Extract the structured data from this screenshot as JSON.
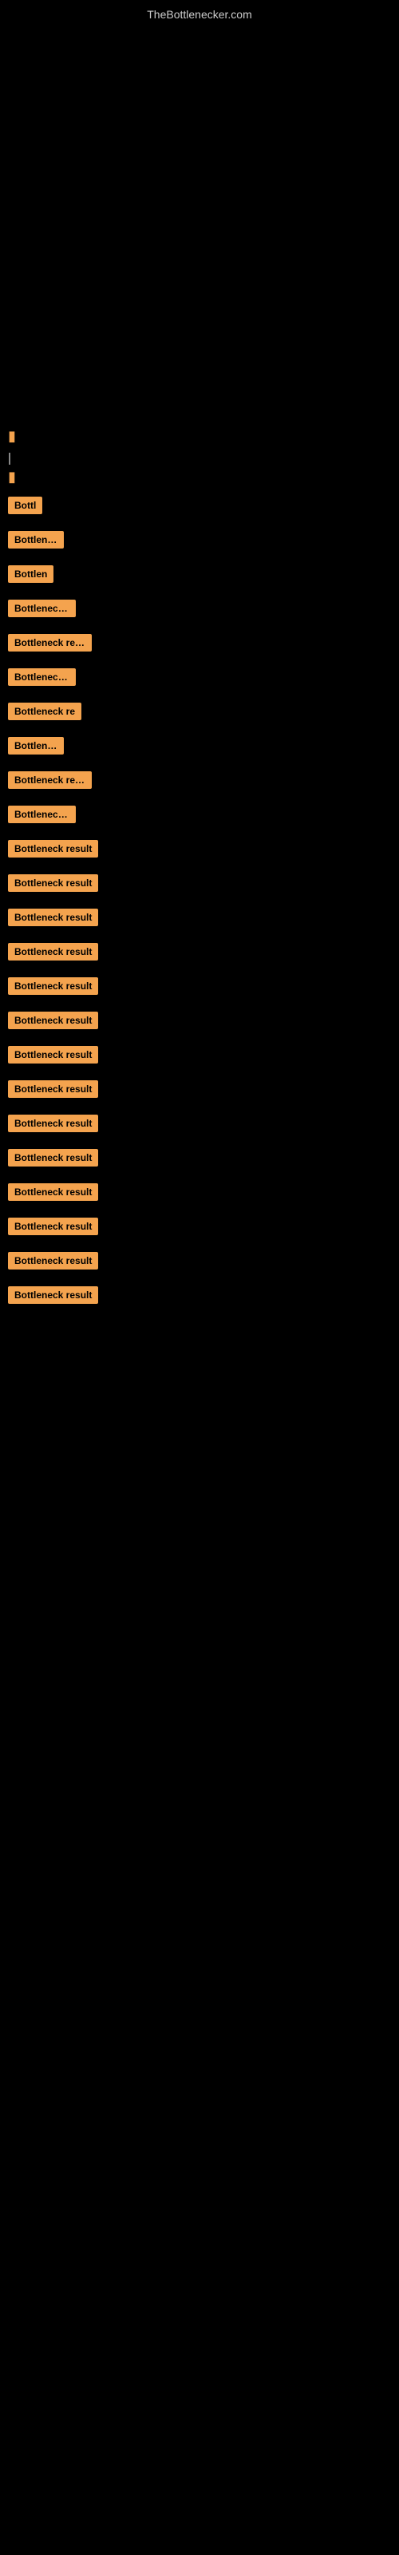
{
  "site": {
    "title": "TheBottlenecker.com"
  },
  "sections": [
    {
      "id": 1,
      "label": "Bottl",
      "size_class": "label-xs",
      "visible": true
    },
    {
      "id": 2,
      "label": "Bottleneck",
      "size_class": "label-sm",
      "visible": true
    },
    {
      "id": 3,
      "label": "Bottlen",
      "size_class": "label-sm",
      "visible": true
    },
    {
      "id": 4,
      "label": "Bottleneck r",
      "size_class": "label-md",
      "visible": true
    },
    {
      "id": 5,
      "label": "Bottleneck resu",
      "size_class": "label-lg",
      "visible": true
    },
    {
      "id": 6,
      "label": "Bottleneck r",
      "size_class": "label-md",
      "visible": true
    },
    {
      "id": 7,
      "label": "Bottleneck re",
      "size_class": "label-lg",
      "visible": true
    },
    {
      "id": 8,
      "label": "Bottleneck",
      "size_class": "label-sm",
      "visible": true
    },
    {
      "id": 9,
      "label": "Bottleneck resu",
      "size_class": "label-lg",
      "visible": true
    },
    {
      "id": 10,
      "label": "Bottleneck re",
      "size_class": "label-md",
      "visible": true
    },
    {
      "id": 11,
      "label": "Bottleneck result",
      "size_class": "label-xl",
      "visible": true
    },
    {
      "id": 12,
      "label": "Bottleneck result",
      "size_class": "label-xl",
      "visible": true
    },
    {
      "id": 13,
      "label": "Bottleneck result",
      "size_class": "label-xl",
      "visible": true
    },
    {
      "id": 14,
      "label": "Bottleneck result",
      "size_class": "label-xl",
      "visible": true
    },
    {
      "id": 15,
      "label": "Bottleneck result",
      "size_class": "label-xl",
      "visible": true
    },
    {
      "id": 16,
      "label": "Bottleneck result",
      "size_class": "label-xl",
      "visible": true
    },
    {
      "id": 17,
      "label": "Bottleneck result",
      "size_class": "label-xl",
      "visible": true
    },
    {
      "id": 18,
      "label": "Bottleneck result",
      "size_class": "label-xl",
      "visible": true
    },
    {
      "id": 19,
      "label": "Bottleneck result",
      "size_class": "label-xl",
      "visible": true
    },
    {
      "id": 20,
      "label": "Bottleneck result",
      "size_class": "label-xl",
      "visible": true
    },
    {
      "id": 21,
      "label": "Bottleneck result",
      "size_class": "label-xl",
      "visible": true
    },
    {
      "id": 22,
      "label": "Bottleneck result",
      "size_class": "label-xl",
      "visible": true
    },
    {
      "id": 23,
      "label": "Bottleneck result",
      "size_class": "label-xl",
      "visible": true
    },
    {
      "id": 24,
      "label": "Bottleneck result",
      "size_class": "label-xl",
      "visible": true
    }
  ]
}
